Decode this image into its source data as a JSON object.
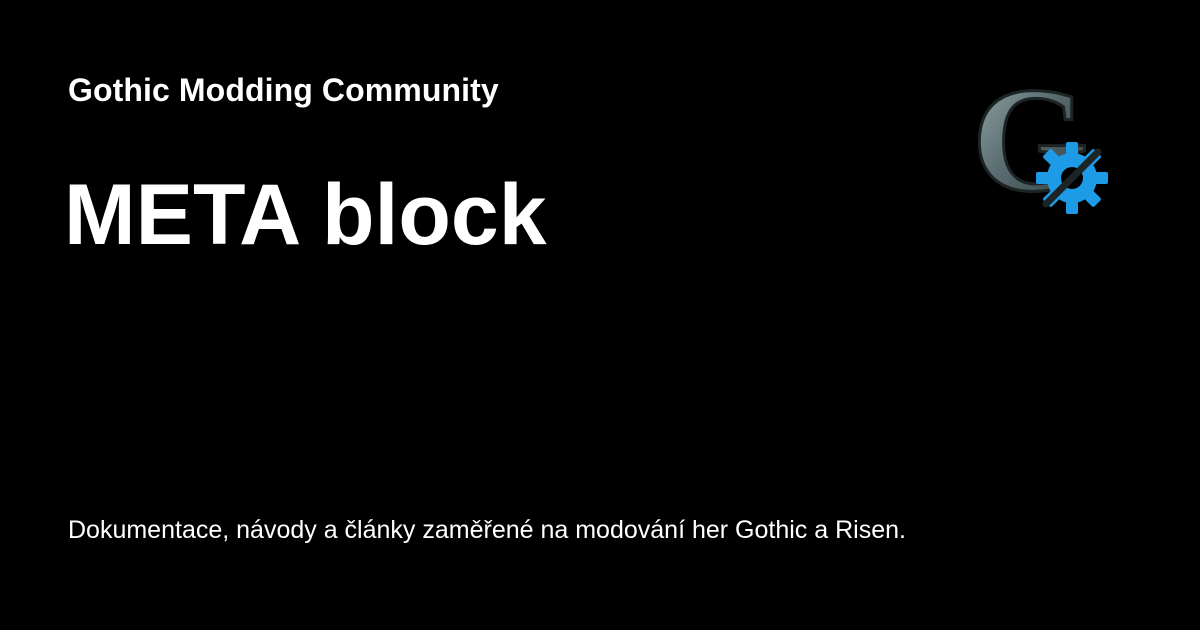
{
  "card": {
    "site_name": "Gothic Modding Community",
    "page_title": "META block",
    "description": "Dokumentace, návody a články zaměřené na modování her Gothic a Risen."
  },
  "logo": {
    "letter": "G",
    "icon": "gear-icon",
    "letter_color": "#5f7275",
    "gear_color": "#1e9be6"
  }
}
